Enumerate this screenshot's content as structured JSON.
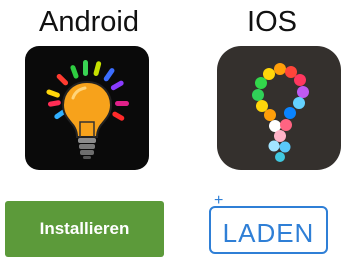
{
  "platforms": {
    "android": {
      "label": "Android",
      "icon": "lightbulb-icon",
      "button_label": "Installieren",
      "button_color": "#5c9a3a"
    },
    "ios": {
      "label": "IOS",
      "icon": "colorful-dots-lightbulb-icon",
      "button_label": "LADEN",
      "button_plus": "+",
      "button_color": "#2f7fd6"
    }
  }
}
